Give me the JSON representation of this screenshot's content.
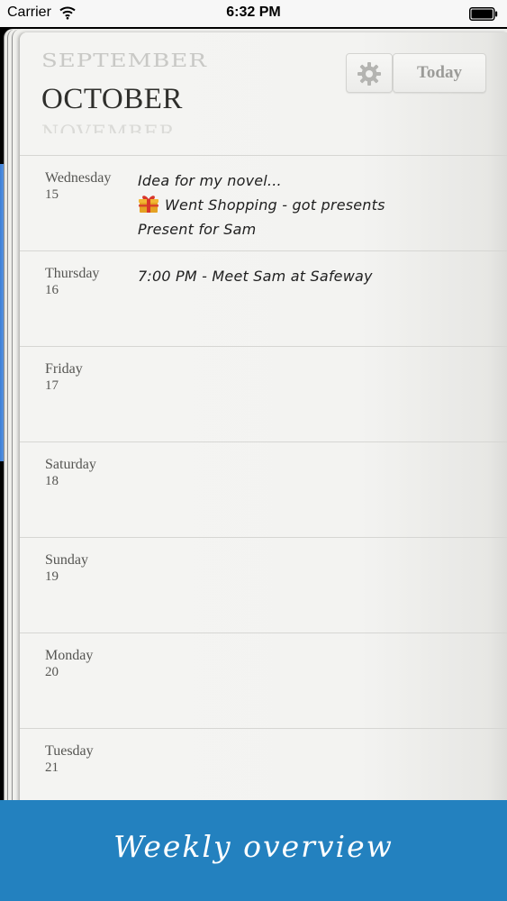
{
  "status_bar": {
    "carrier": "Carrier",
    "time": "6:32 PM"
  },
  "header": {
    "previous_month": "SEPTEMBER",
    "current_month": "OCTOBER",
    "next_month": "NOVEMBER",
    "settings_icon": "gear-icon",
    "today_label": "Today"
  },
  "days": [
    {
      "name": "Wednesday",
      "date": "15",
      "entries": [
        {
          "text": "Idea for my novel...",
          "icon": ""
        },
        {
          "text": "Went Shopping - got presents",
          "icon": "gift-icon"
        },
        {
          "text": "Present for Sam",
          "icon": ""
        }
      ]
    },
    {
      "name": "Thursday",
      "date": "16",
      "entries": [
        {
          "text": "7:00 PM - Meet Sam at Safeway",
          "icon": ""
        }
      ]
    },
    {
      "name": "Friday",
      "date": "17",
      "entries": []
    },
    {
      "name": "Saturday",
      "date": "18",
      "entries": []
    },
    {
      "name": "Sunday",
      "date": "19",
      "entries": []
    },
    {
      "name": "Monday",
      "date": "20",
      "entries": []
    },
    {
      "name": "Tuesday",
      "date": "21",
      "entries": []
    }
  ],
  "banner": {
    "text": "Weekly overview"
  },
  "colors": {
    "banner": "#2381bf",
    "paper": "#f3f3f1",
    "ink": "#1f1f1f"
  }
}
